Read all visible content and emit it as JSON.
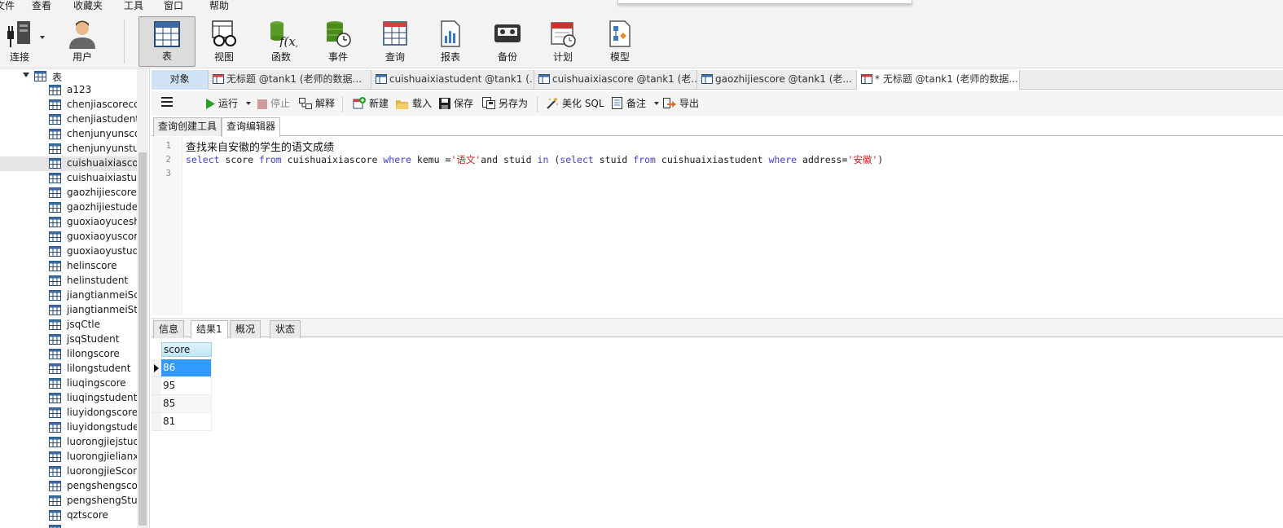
{
  "menu": [
    "文件",
    "查看",
    "收藏夹",
    "工具",
    "窗口",
    "帮助"
  ],
  "toolbar": {
    "connect": "连接",
    "user": "用户",
    "table": "表",
    "view": "视图",
    "function": "函数",
    "event": "事件",
    "query": "查询",
    "report": "报表",
    "backup": "备份",
    "schedule": "计划",
    "model": "模型"
  },
  "tree": {
    "root": "表",
    "items": [
      "a123",
      "chenjiascorecc",
      "chenjiastudentc",
      "chenjunyunscor",
      "chenjunyunstuc",
      "cuishuaixiascor",
      "cuishuaixiastud",
      "gaozhijiescore",
      "gaozhijiestude",
      "guoxiaoyucesh",
      "guoxiaoyuscor",
      "guoxiaoyustud",
      "helinscore",
      "helinstudent",
      "jiangtianmeiSco",
      "jiangtianmeiStu",
      "jsqCtle",
      "jsqStudent",
      "lilongscore",
      "lilongstudent",
      "liuqingscore",
      "liuqingstudent",
      "liuyidongscore",
      "liuyidongstude",
      "luorongjiejstud",
      "luorongjielianx",
      "luorongjieScor",
      "pengshengscor",
      "pengshengStuc",
      "qztscore",
      "..."
    ]
  },
  "tabs": [
    {
      "label": "对象"
    },
    {
      "label": "无标题 @tank1 (老师的数据..."
    },
    {
      "label": "cuishuaixiastudent @tank1 (..."
    },
    {
      "label": "cuishuaixiascore @tank1 (老..."
    },
    {
      "label": "gaozhijiescore @tank1 (老..."
    },
    {
      "label": "* 无标题 @tank1 (老师的数据..."
    }
  ],
  "query_toolbar": {
    "run": "运行",
    "stop": "停止",
    "explain": "解释",
    "new": "新建",
    "load": "载入",
    "save": "保存",
    "save_as": "另存为",
    "beautify": "美化 SQL",
    "comment": "备注",
    "export": "导出"
  },
  "subtabs": [
    "查询创建工具",
    "查询编辑器"
  ],
  "editor": {
    "line_numbers": [
      "1",
      "2",
      "3"
    ],
    "line1": "查找来自安徽的学生的语文成绩",
    "line2": {
      "t1": "select",
      "t2": " score ",
      "t3": "from",
      "t4": " cuishuaixiascore ",
      "t5": "where",
      "t6": " kemu =",
      "t7": "'语文'",
      "t8": "and stuid ",
      "t9": "in",
      "t10": " (",
      "t11": "select",
      "t12": " stuid ",
      "t13": "from",
      "t14": " cuishuaixiastudent ",
      "t15": "where",
      "t16": " address=",
      "t17": "'安徽'",
      "t18": ")"
    }
  },
  "result_tabs": [
    "信息",
    "结果1",
    "概况",
    "状态"
  ],
  "result": {
    "column": "score",
    "rows": [
      "86",
      "95",
      "85",
      "81"
    ]
  }
}
